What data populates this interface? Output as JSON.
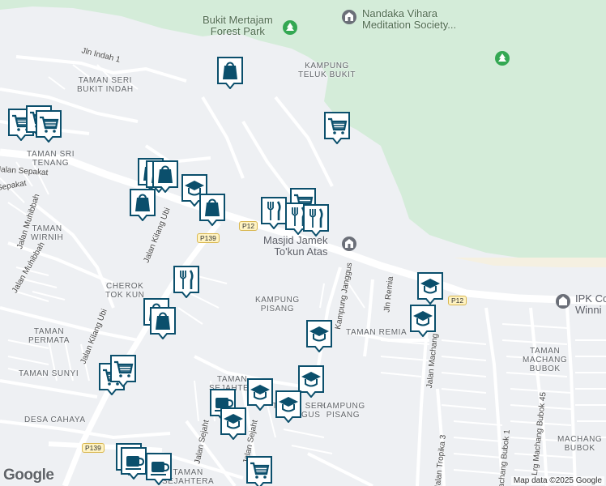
{
  "map": {
    "attribution": "Map data ©2025 Google",
    "logo_text": "Google",
    "colors": {
      "background": "#eef0f3",
      "park": "#d4ecd9",
      "road": "#ffffff",
      "marker": "#0b4f6c",
      "shield_fill": "#fff3c2"
    },
    "pois": [
      {
        "id": "forest-park",
        "name": "Bukit Mertajam\nForest Park",
        "icon": "tree-icon"
      },
      {
        "id": "meditation",
        "name": "Nandaka Vihara\nMeditation Society...",
        "icon": "worship-icon"
      },
      {
        "id": "masjid",
        "name": "Masjid Jamek\nTo'kun Atas",
        "icon": "mosque-icon"
      },
      {
        "id": "ipk",
        "name": "IPK Cc\nWinni",
        "icon": "place-icon"
      }
    ],
    "area_labels": [
      "KAMPUNG\nTELUK BUKIT",
      "TAMAN SERI\nBUKIT INDAH",
      "TAMAN SRI\nTENANG",
      "CHEROK\nTOK KUN",
      "KAMPUNG\nPISANG",
      "TAMAN\nPERMATA",
      "TAMAN SUNYI",
      "DESA CAHAYA",
      "TAMAN REMIA",
      "TAMAN\nSEJAHTER",
      "KAMPUNG\nPISANG",
      "TAMAN SERI\nJANGGUS",
      "TAMAN\nMACHANG\nBUBOK",
      "MACHANG\nBUBOK",
      "TAMAN\nSEJAHTERA",
      "TAMAN\nWIRNIH"
    ],
    "road_labels": [
      "Jln Indah 1",
      "Jalan Sepakat",
      "Sepakat",
      "Jalan Kilang Ubi",
      "Jalan Kilang Ubi",
      "Jalan Muhibbah",
      "Jln Remia",
      "Kampung Janggus",
      "Jalan Machang",
      "Jalan Sejaht",
      "Jalan Sejaht",
      "Jalan Tropika 3",
      "Machang Bubok 1",
      "Lrg Machang Bubok 45",
      "Jalan Muhibbah"
    ],
    "route_shields": [
      "P12",
      "P139",
      "P12",
      "P139"
    ],
    "markers": [
      "shopping-bag-icon",
      "cart-icon",
      "cart-icon",
      "cart-icon",
      "shopping-bag-icon",
      "shopping-bag-icon",
      "shopping-bag-icon",
      "school-icon",
      "shopping-bag-icon",
      "cart-icon",
      "restaurant-icon",
      "restaurant-icon",
      "restaurant-icon",
      "shopping-bag-icon",
      "restaurant-icon",
      "shopping-bag-icon",
      "shopping-bag-icon",
      "cart-icon",
      "school-icon",
      "school-icon",
      "cart-icon",
      "cart-icon",
      "school-icon",
      "school-icon",
      "school-icon",
      "school-icon",
      "coffee-icon",
      "school-icon",
      "coffee-icon",
      "coffee-icon",
      "coffee-icon",
      "cart-icon"
    ]
  }
}
